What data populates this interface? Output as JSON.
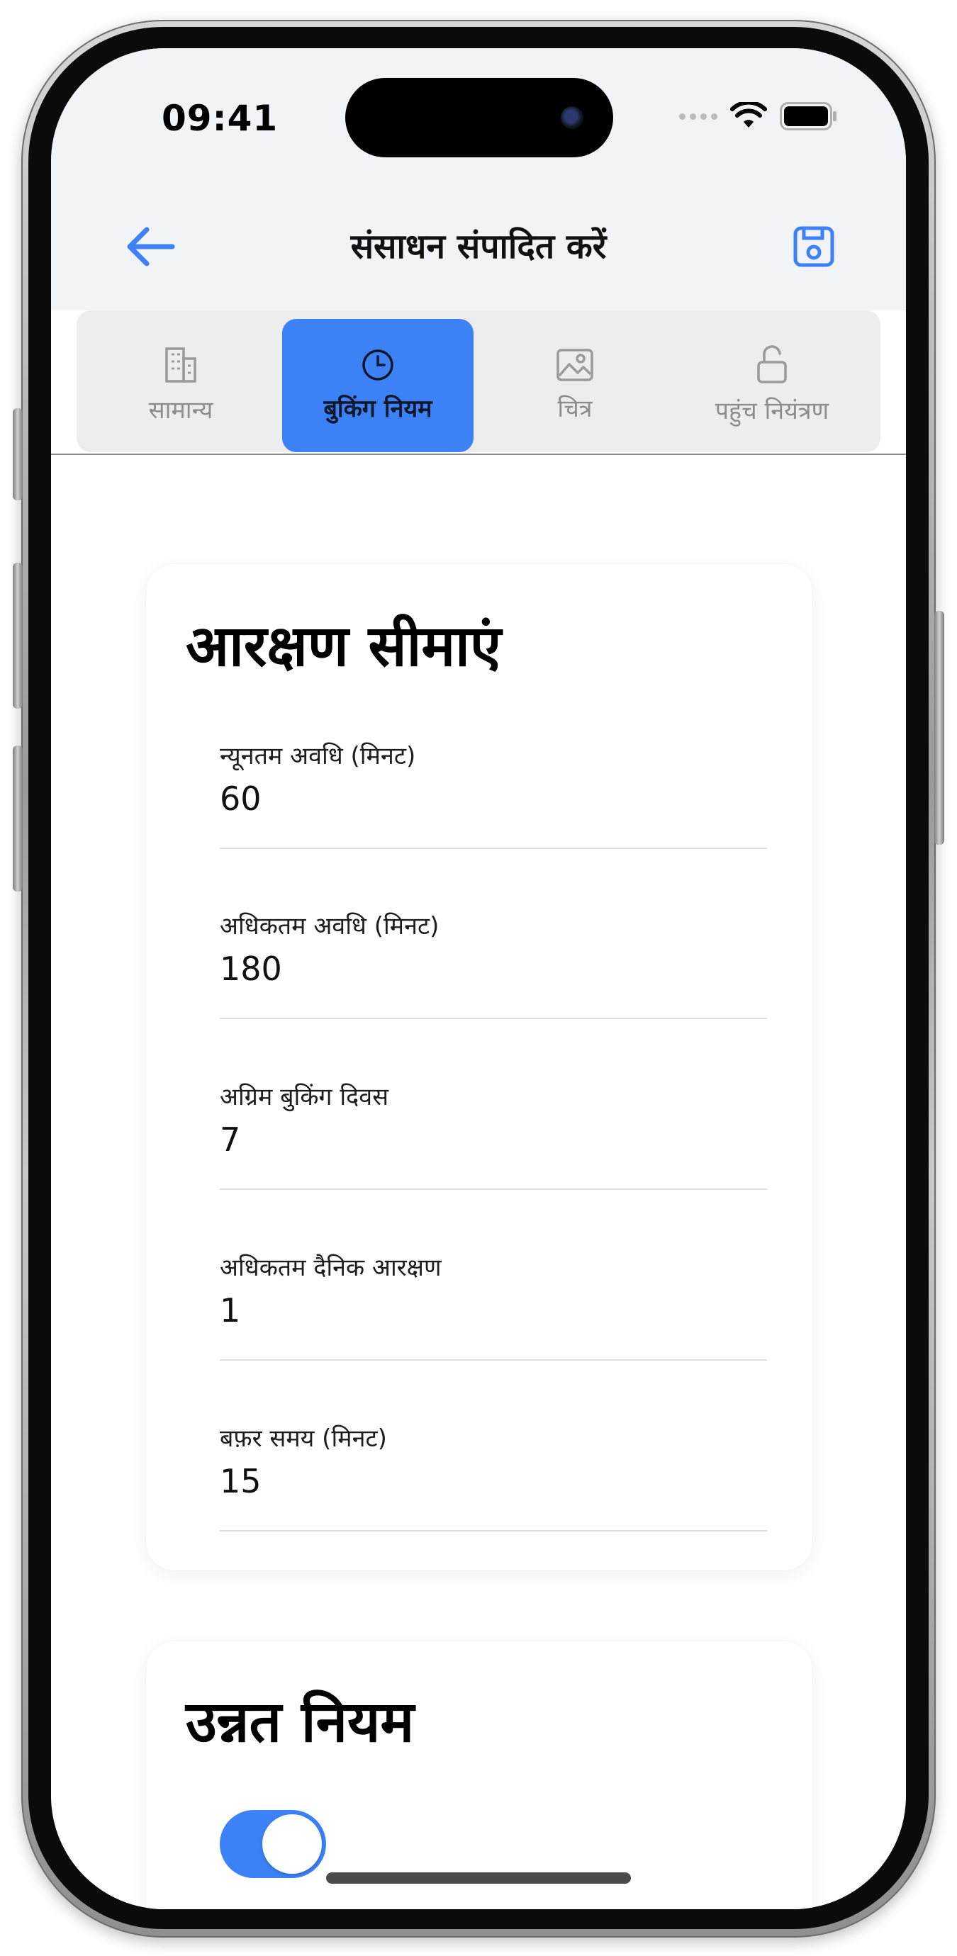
{
  "status_bar": {
    "time": "09:41"
  },
  "nav": {
    "title": "संसाधन संपादित करें"
  },
  "tabs": [
    {
      "label": "सामान्य",
      "icon": "building-icon",
      "active": false
    },
    {
      "label": "बुकिंग नियम",
      "icon": "clock-icon",
      "active": true
    },
    {
      "label": "चित्र",
      "icon": "image-icon",
      "active": false
    },
    {
      "label": "पहुंच नियंत्रण",
      "icon": "unlock-icon",
      "active": false
    }
  ],
  "reservation_limits": {
    "title": "आरक्षण सीमाएं",
    "fields": [
      {
        "label": "न्यूनतम अवधि (मिनट)",
        "value": "60"
      },
      {
        "label": "अधिकतम अवधि (मिनट)",
        "value": "180"
      },
      {
        "label": "अग्रिम बुकिंग दिवस",
        "value": "7"
      },
      {
        "label": "अधिकतम दैनिक आरक्षण",
        "value": "1"
      },
      {
        "label": "बफ़र समय (मिनट)",
        "value": "15"
      }
    ]
  },
  "advanced_rules": {
    "title": "उन्नत नियम",
    "toggle_on": true
  },
  "colors": {
    "accent": "#3c82f6",
    "nav_bg": "#f2f3f7",
    "tab_bg": "#ededed"
  }
}
